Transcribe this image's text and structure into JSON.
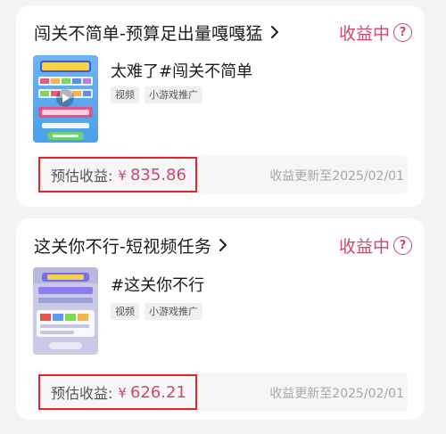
{
  "tasks": [
    {
      "title": "闯关不简单-预算足出量嘎嘎猛",
      "status": "收益中",
      "help_icon": "?",
      "description": "太难了#闯关不简单",
      "tags": [
        "视频",
        "小游戏推广"
      ],
      "income_label": "预估收益:",
      "currency": "¥",
      "income_value": "835.86",
      "update_text": "收益更新至2025/02/01"
    },
    {
      "title": "这关你不行-短视频任务",
      "status": "收益中",
      "help_icon": "?",
      "description": "#这关你不行",
      "tags": [
        "视频",
        "小游戏推广"
      ],
      "income_label": "预估收益:",
      "currency": "¥",
      "income_value": "626.21",
      "update_text": "收益更新至2025/02/01"
    }
  ],
  "colors": {
    "accent": "#cc4a67",
    "highlight_border": "#e2242c",
    "background": "#f4f4f6",
    "card": "#ffffff"
  },
  "icons": {
    "chevron": "chevron-right-icon",
    "help": "question-circle-icon",
    "play": "play-icon"
  }
}
